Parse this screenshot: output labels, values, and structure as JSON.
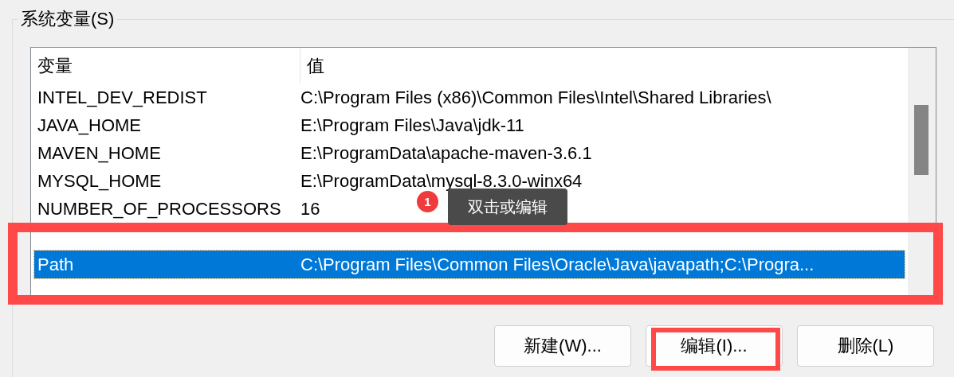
{
  "group": {
    "title": "系统变量(S)"
  },
  "table": {
    "columns": [
      "变量",
      "值"
    ],
    "rows": [
      {
        "name": "INTEL_DEV_REDIST",
        "value": "C:\\Program Files (x86)\\Common Files\\Intel\\Shared Libraries\\",
        "selected": false
      },
      {
        "name": "JAVA_HOME",
        "value": "E:\\Program Files\\Java\\jdk-11",
        "selected": false
      },
      {
        "name": "MAVEN_HOME",
        "value": "E:\\ProgramData\\apache-maven-3.6.1",
        "selected": false
      },
      {
        "name": "MYSQL_HOME",
        "value": "E:\\ProgramData\\mysql-8.3.0-winx64",
        "selected": false
      },
      {
        "name": "NUMBER_OF_PROCESSORS",
        "value": "16",
        "selected": false
      }
    ],
    "framed_rows": [
      {
        "name": "Path",
        "value": "C:\\Program Files\\Common Files\\Oracle\\Java\\javapath;C:\\Progra...",
        "selected": true
      }
    ]
  },
  "annotation": {
    "step": "1",
    "tooltip": "双击或编辑"
  },
  "buttons": [
    "新建(W)...",
    "编辑(I)...",
    "删除(L)"
  ]
}
